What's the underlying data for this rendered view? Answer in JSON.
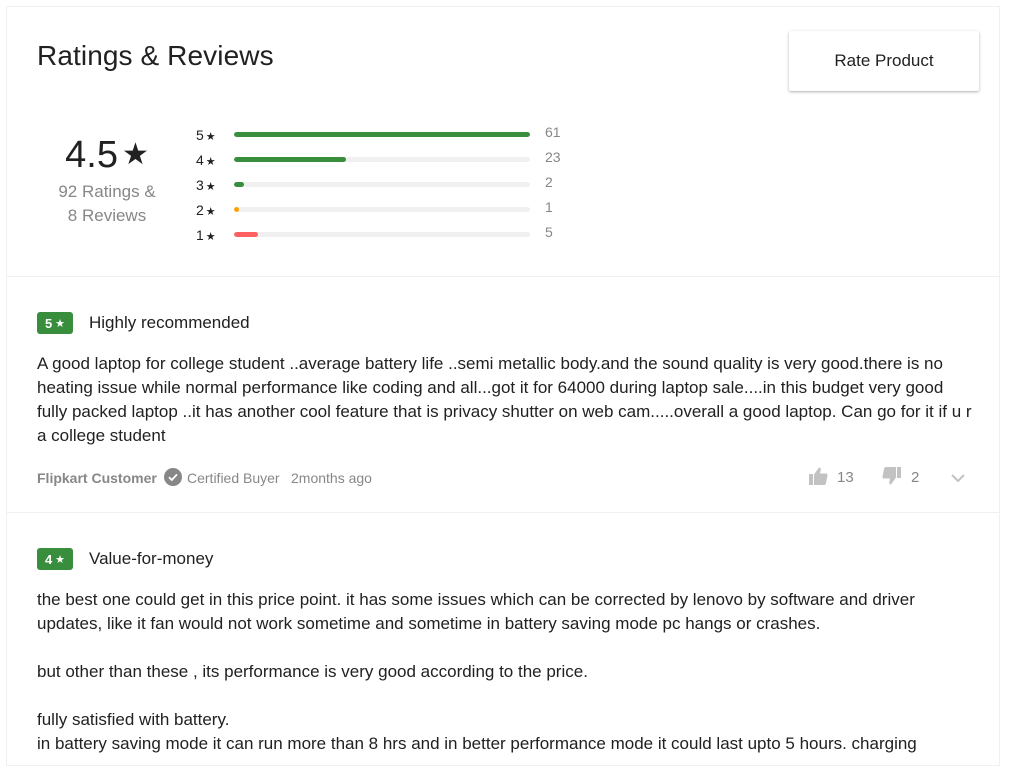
{
  "header": {
    "title": "Ratings & Reviews",
    "rate_button": "Rate Product"
  },
  "summary": {
    "average": "4.5",
    "star": "★",
    "ratings_line": "92 Ratings &",
    "reviews_line": "8 Reviews"
  },
  "distribution": [
    {
      "label": "5",
      "star": "★",
      "count": "61",
      "fraction": 1.0,
      "color": "#388e3c"
    },
    {
      "label": "4",
      "star": "★",
      "count": "23",
      "fraction": 0.377,
      "color": "#388e3c"
    },
    {
      "label": "3",
      "star": "★",
      "count": "2",
      "fraction": 0.033,
      "color": "#388e3c"
    },
    {
      "label": "2",
      "star": "★",
      "count": "1",
      "fraction": 0.016,
      "color": "#ff9f00"
    },
    {
      "label": "1",
      "star": "★",
      "count": "5",
      "fraction": 0.082,
      "color": "#ff6161"
    }
  ],
  "reviews": [
    {
      "rating": "5",
      "star": "★",
      "title": "Highly recommended",
      "text": "A good laptop for college student ..average battery life ..semi metallic body.and the sound quality is very good.there is no heating issue while normal performance like coding and all...got it for 64000 during laptop sale....in this budget very good fully packed laptop ..it has another cool feature that is privacy shutter on web cam.....overall a good laptop. Can go for it if u r a college student",
      "author": "Flipkart Customer",
      "certified": "Certified Buyer",
      "time": "2months ago",
      "likes": "13",
      "dislikes": "2"
    },
    {
      "rating": "4",
      "star": "★",
      "title": "Value-for-money",
      "text": "the best one could get in this price point. it has some issues which can be corrected by lenovo by software and driver updates, like it fan would not work sometime and sometime in battery saving mode pc hangs or crashes.\n\nbut other than these , its performance is very good according to the price.\n\nfully satisfied with battery.\nin battery saving mode it can run more than 8 hrs and in better performance mode it could last upto 5 hours. charging"
    }
  ],
  "colors": {
    "accent_green": "#388e3c",
    "muted_text": "#878787",
    "divider": "#f0f0f0"
  }
}
